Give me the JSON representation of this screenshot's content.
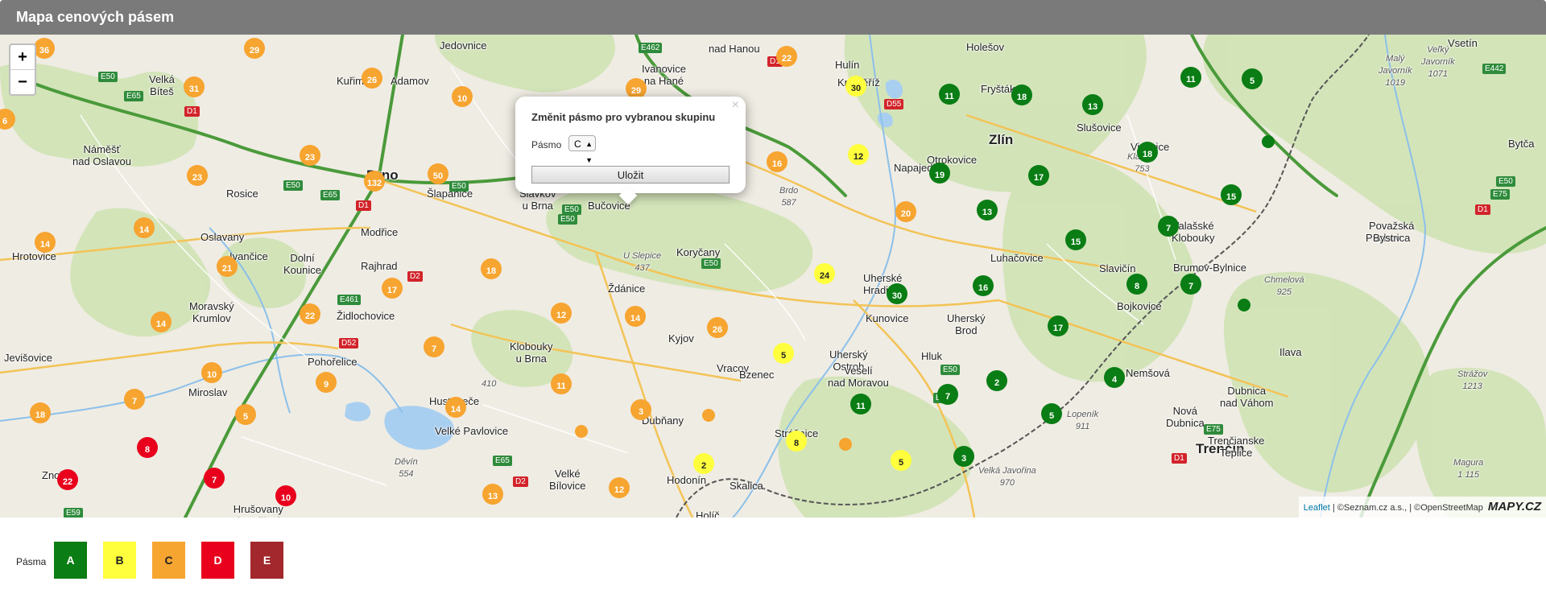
{
  "title": "Mapa cenových pásem",
  "zoom": {
    "in": "+",
    "out": "−"
  },
  "popup": {
    "title": "Změnit pásmo pro vybranou skupinu",
    "field_label": "Pásmo",
    "select_value": "C",
    "save_label": "Uložit",
    "close": "×"
  },
  "attribution": {
    "leaflet": "Leaflet",
    "rest": " | ©Seznam.cz a.s., | ©OpenStreetMap",
    "logo": "MAPY.CZ"
  },
  "legend": {
    "label": "Pásma",
    "bands": [
      {
        "label": "A",
        "color": "#0a7d14"
      },
      {
        "label": "B",
        "color": "#ffff3d"
      },
      {
        "label": "C",
        "color": "#f7a531"
      },
      {
        "label": "D",
        "color": "#e8001c"
      },
      {
        "label": "E",
        "color": "#a2282d"
      }
    ]
  },
  "places": [
    {
      "name": "Holešov"
    },
    {
      "name": "Vsetín"
    },
    {
      "name": "Kuřim"
    },
    {
      "name": "Adamov"
    },
    {
      "name": "Velká\nBíteš"
    },
    {
      "name": "Ivanovice\nna Hané"
    },
    {
      "name": "nad Hanou"
    },
    {
      "name": "Hulín"
    },
    {
      "name": "Kroměříž"
    },
    {
      "name": "Fryšták"
    },
    {
      "name": "Slušovice"
    },
    {
      "name": "Vizovice"
    },
    {
      "name": "Zlín"
    },
    {
      "name": "Otrokovice"
    },
    {
      "name": "Napajedla"
    },
    {
      "name": "Brno"
    },
    {
      "name": "Rosice"
    },
    {
      "name": "Šlapanice"
    },
    {
      "name": "Slavkov\nu Brna"
    },
    {
      "name": "Bučovice"
    },
    {
      "name": "Modřice"
    },
    {
      "name": "Oslavany"
    },
    {
      "name": "Ivančice"
    },
    {
      "name": "Rajhrad"
    },
    {
      "name": "Dolní\nKounice"
    },
    {
      "name": "Židlochovice"
    },
    {
      "name": "Moravský\nKrumlov"
    },
    {
      "name": "Pohořelice"
    },
    {
      "name": "Miroslav"
    },
    {
      "name": "Hustopeče"
    },
    {
      "name": "Velké Pavlovice"
    },
    {
      "name": "Klobouky\nu Brna"
    },
    {
      "name": "Ždánice"
    },
    {
      "name": "Koryčany"
    },
    {
      "name": "Kyjov"
    },
    {
      "name": "Vracov"
    },
    {
      "name": "Bzenec"
    },
    {
      "name": "Dubňany"
    },
    {
      "name": "Hodonín"
    },
    {
      "name": "Skalica"
    },
    {
      "name": "Strážnice"
    },
    {
      "name": "Uherské\nHradiště"
    },
    {
      "name": "Kunovice"
    },
    {
      "name": "Uherský\nOstroh"
    },
    {
      "name": "Veselí\nnad Moravou"
    },
    {
      "name": "Hluk"
    },
    {
      "name": "Uherský\nBrod"
    },
    {
      "name": "Luhačovice"
    },
    {
      "name": "Slavičín"
    },
    {
      "name": "Bojkovice"
    },
    {
      "name": "Valašské\nKlobouky"
    },
    {
      "name": "Brumov-Bylnice"
    },
    {
      "name": "Trenčín"
    },
    {
      "name": "Trenčianske\nTeplice"
    },
    {
      "name": "Nová\nDubnica"
    },
    {
      "name": "Dubnica\nnad Váhom"
    },
    {
      "name": "Nemšová"
    },
    {
      "name": "Ilava"
    },
    {
      "name": "Púchov"
    },
    {
      "name": "Považská\nBystrica"
    },
    {
      "name": "Bytča"
    },
    {
      "name": "Velké\nBílovice"
    },
    {
      "name": "Hrušovany\nnad Jevišovkou"
    },
    {
      "name": "Znojmo"
    },
    {
      "name": "Jevišovice"
    },
    {
      "name": "Hrotovice"
    },
    {
      "name": "Náměšť\nnad Oslavou"
    },
    {
      "name": "Jedovnice"
    },
    {
      "name": "Holíč"
    }
  ],
  "hills": [
    {
      "name": "Brdo\n587"
    },
    {
      "name": "U Slepice\n437"
    },
    {
      "name": "410"
    },
    {
      "name": "Děvín\n554"
    },
    {
      "name": "Lopeník\n911"
    },
    {
      "name": "Velká Javořina\n970"
    },
    {
      "name": "Chmelová\n925"
    },
    {
      "name": "Magura\n1 115"
    },
    {
      "name": "Strážov\n1213"
    },
    {
      "name": "Malý\nJavorník\n1019"
    },
    {
      "name": "Veľký\nJavorník\n1071"
    },
    {
      "name": "Klášťov\n753"
    }
  ],
  "roads": [
    {
      "label": "E462"
    },
    {
      "label": "D1"
    },
    {
      "label": "E50"
    },
    {
      "label": "E65"
    },
    {
      "label": "D1"
    },
    {
      "label": "E50"
    },
    {
      "label": "E65"
    },
    {
      "label": "D1"
    },
    {
      "label": "E50"
    },
    {
      "label": "E50"
    },
    {
      "label": "D55"
    },
    {
      "label": "E442"
    },
    {
      "label": "E50"
    },
    {
      "label": "E75"
    },
    {
      "label": "D1"
    },
    {
      "label": "D2"
    },
    {
      "label": "E461"
    },
    {
      "label": "D52"
    },
    {
      "label": "E65"
    },
    {
      "label": "D2"
    },
    {
      "label": "E50"
    },
    {
      "label": "E50"
    },
    {
      "label": "E50"
    },
    {
      "label": "E50"
    },
    {
      "label": "E75"
    },
    {
      "label": "D1"
    },
    {
      "label": "E59"
    }
  ],
  "markers": [
    {
      "value": "36",
      "band": "C"
    },
    {
      "value": "29",
      "band": "C"
    },
    {
      "value": "26",
      "band": "C"
    },
    {
      "value": "31",
      "band": "C"
    },
    {
      "value": "10",
      "band": "C"
    },
    {
      "value": "22",
      "band": "C"
    },
    {
      "value": "29",
      "band": "C"
    },
    {
      "value": "30",
      "band": "B"
    },
    {
      "value": "11",
      "band": "A"
    },
    {
      "value": "18",
      "band": "A"
    },
    {
      "value": "13",
      "band": "A"
    },
    {
      "value": "11",
      "band": "A"
    },
    {
      "value": "5",
      "band": "A"
    },
    {
      "value": "23",
      "band": "C"
    },
    {
      "value": "23",
      "band": "C"
    },
    {
      "value": "50",
      "band": "C"
    },
    {
      "value": "132",
      "band": "C"
    },
    {
      "value": "16",
      "band": "C"
    },
    {
      "value": "12",
      "band": "B"
    },
    {
      "value": "19",
      "band": "A"
    },
    {
      "value": "17",
      "band": "A"
    },
    {
      "value": "18",
      "band": "A"
    },
    {
      "value": "15",
      "band": "A"
    },
    {
      "value": "13",
      "band": "A"
    },
    {
      "value": "20",
      "band": "C"
    },
    {
      "value": "14",
      "band": "C"
    },
    {
      "value": "14",
      "band": "C"
    },
    {
      "value": "21",
      "band": "C"
    },
    {
      "value": "18",
      "band": "C"
    },
    {
      "value": "17",
      "band": "C"
    },
    {
      "value": "22",
      "band": "C"
    },
    {
      "value": "24",
      "band": "B"
    },
    {
      "value": "30",
      "band": "A"
    },
    {
      "value": "15",
      "band": "A"
    },
    {
      "value": "7",
      "band": "A"
    },
    {
      "value": "16",
      "band": "A"
    },
    {
      "value": "8",
      "band": "A"
    },
    {
      "value": "7",
      "band": "A"
    },
    {
      "value": "14",
      "band": "C"
    },
    {
      "value": "12",
      "band": "C"
    },
    {
      "value": "14",
      "band": "C"
    },
    {
      "value": "26",
      "band": "C"
    },
    {
      "value": "17",
      "band": "A"
    },
    {
      "value": "7",
      "band": "C"
    },
    {
      "value": "5",
      "band": "B"
    },
    {
      "value": "9",
      "band": "C"
    },
    {
      "value": "10",
      "band": "C"
    },
    {
      "value": "7",
      "band": "C"
    },
    {
      "value": "11",
      "band": "C"
    },
    {
      "value": "18",
      "band": "C"
    },
    {
      "value": "5",
      "band": "C"
    },
    {
      "value": "14",
      "band": "C"
    },
    {
      "value": "3",
      "band": "C"
    },
    {
      "value": "2",
      "band": "A"
    },
    {
      "value": "4",
      "band": "A"
    },
    {
      "value": "7",
      "band": "A"
    },
    {
      "value": "11",
      "band": "A"
    },
    {
      "value": "5",
      "band": "A"
    },
    {
      "value": "8",
      "band": "D"
    },
    {
      "value": "7",
      "band": "D"
    },
    {
      "value": "22",
      "band": "D"
    },
    {
      "value": "10",
      "band": "D"
    },
    {
      "value": "13",
      "band": "C"
    },
    {
      "value": "12",
      "band": "C"
    },
    {
      "value": "2",
      "band": "B"
    },
    {
      "value": "8",
      "band": "B"
    },
    {
      "value": "5",
      "band": "B"
    },
    {
      "value": "3",
      "band": "A"
    },
    {
      "value": "6",
      "band": "C"
    },
    {
      "value": "",
      "band": "C"
    },
    {
      "value": "",
      "band": "C"
    },
    {
      "value": "",
      "band": "C"
    },
    {
      "value": "",
      "band": "A"
    },
    {
      "value": "",
      "band": "A"
    }
  ]
}
